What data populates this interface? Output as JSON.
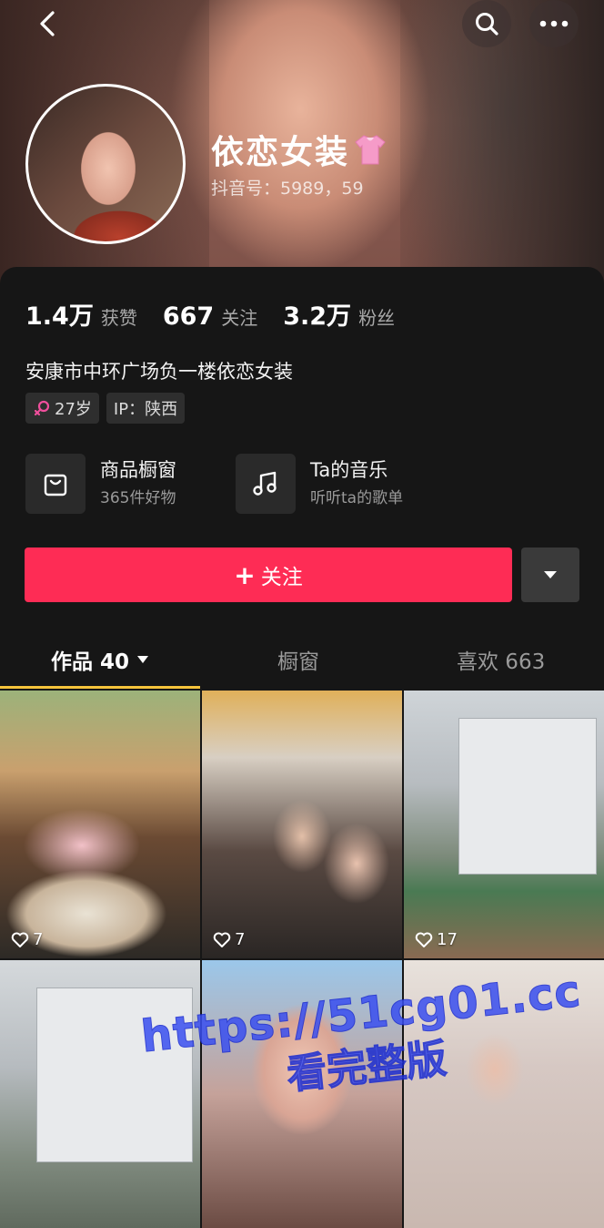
{
  "header": {
    "back_icon": "back-arrow-icon",
    "search_icon": "search-icon",
    "more_icon": "more-dots-icon"
  },
  "profile": {
    "nickname": "依恋女装",
    "nickname_emoji": "pink-shirt-icon",
    "douyin_id": "抖音号：5989，59"
  },
  "stats": [
    {
      "num": "1.4万",
      "label": "获赞"
    },
    {
      "num": "667",
      "label": "关注"
    },
    {
      "num": "3.2万",
      "label": "粉丝"
    }
  ],
  "bio": "安康市中环广场负一楼依恋女装",
  "tags": {
    "age": "27岁",
    "gender_icon": "female-icon",
    "ip": "IP：陕西"
  },
  "cards": [
    {
      "icon": "shopping-bag-icon",
      "title": "商品橱窗",
      "sub": "365件好物"
    },
    {
      "icon": "music-note-icon",
      "title": "Ta的音乐",
      "sub": "听听ta的歌单"
    }
  ],
  "follow": {
    "label": "关注",
    "plus": "+"
  },
  "tabs": [
    {
      "label": "作品 40"
    },
    {
      "label": "橱窗"
    },
    {
      "label": "喜欢 663"
    }
  ],
  "videos": [
    {
      "likes": "7"
    },
    {
      "likes": "7"
    },
    {
      "likes": "17"
    },
    {
      "likes": ""
    },
    {
      "likes": ""
    },
    {
      "likes": ""
    }
  ],
  "watermark": {
    "url": "https://51cg01.cc",
    "text": "看完整版"
  },
  "colors": {
    "accent": "#fe2c55",
    "tab_underline": "#f5c33b",
    "background": "#161616"
  }
}
